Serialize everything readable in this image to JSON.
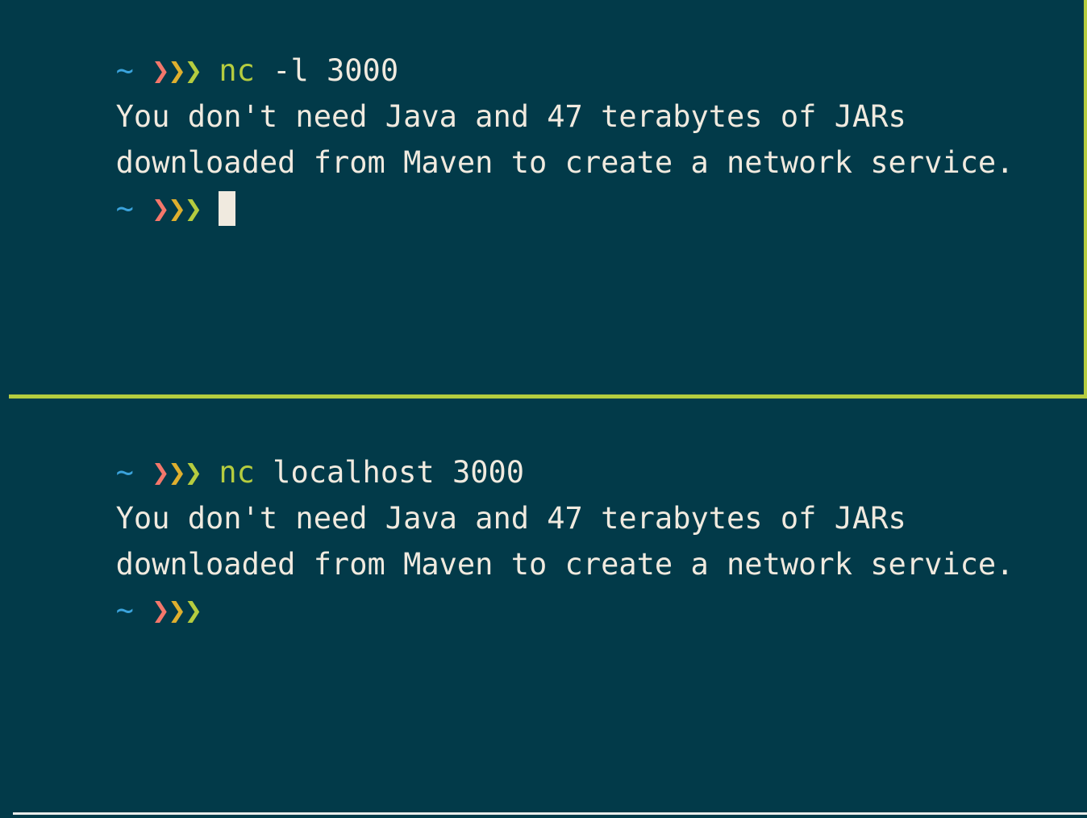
{
  "terminal": {
    "background_color": "#023a49",
    "foreground_color": "#f0eadf",
    "divider_color": "#b5cc3f",
    "prompt": {
      "tilde": "~",
      "chevron": "❯",
      "chevron_colors": [
        "#f4776b",
        "#dfaf2e",
        "#b5cc3f"
      ],
      "tilde_color": "#3ba3dc"
    },
    "cursor": {
      "style": "block",
      "color": "#f0eadf"
    }
  },
  "panes": [
    {
      "id": "top",
      "role": "server",
      "lines": [
        {
          "type": "prompt",
          "cwd": "~",
          "command_name": "nc",
          "command_args": " -l 3000",
          "full_command": "nc -l 3000"
        },
        {
          "type": "output",
          "text": "You don't need Java and 47 terabytes of JARs"
        },
        {
          "type": "output",
          "text": "downloaded from Maven to create a network service."
        },
        {
          "type": "prompt",
          "cwd": "~",
          "command_name": "",
          "command_args": "",
          "full_command": "",
          "cursor": true
        }
      ]
    },
    {
      "id": "bottom",
      "role": "client",
      "lines": [
        {
          "type": "prompt",
          "cwd": "~",
          "command_name": "nc",
          "command_args": " localhost 3000",
          "full_command": "nc localhost 3000"
        },
        {
          "type": "output",
          "text": "You don't need Java and 47 terabytes of JARs"
        },
        {
          "type": "output",
          "text": "downloaded from Maven to create a network service."
        },
        {
          "type": "prompt",
          "cwd": "~",
          "command_name": "",
          "command_args": "",
          "full_command": "",
          "cursor": false
        }
      ]
    }
  ]
}
